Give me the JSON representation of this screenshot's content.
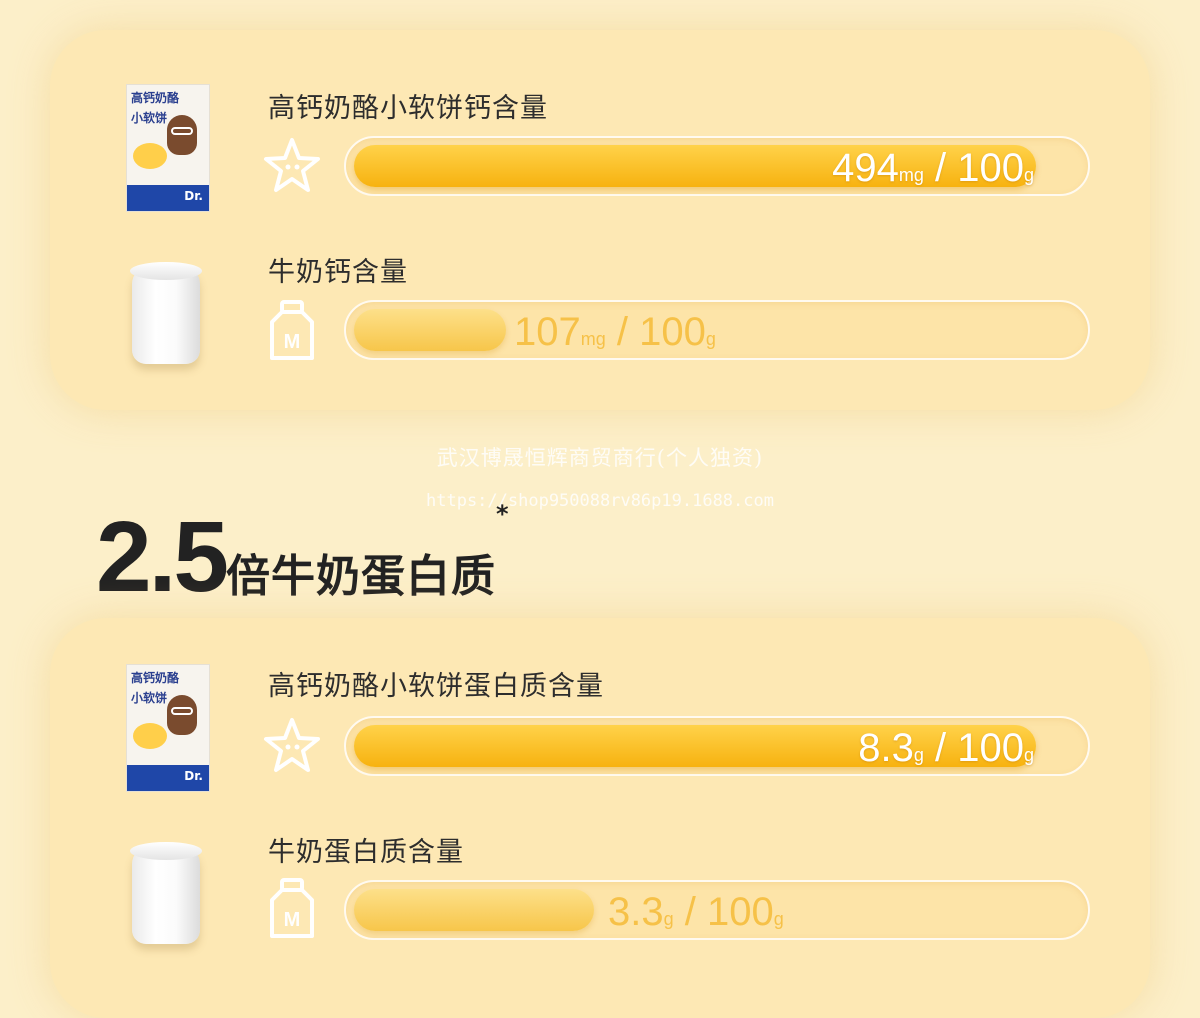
{
  "calcium": {
    "rows": [
      {
        "title": "高钙奶酪小软饼钙含量",
        "value": "494",
        "unit": "mg",
        "separator": "/",
        "base": "100",
        "base_unit": "g",
        "bar_fraction": 0.94,
        "icon": "star-icon"
      },
      {
        "title": "牛奶钙含量",
        "value": "107",
        "unit": "mg",
        "separator": "/",
        "base": "100",
        "base_unit": "g",
        "bar_fraction": 0.21,
        "icon": "milk-bottle-icon"
      }
    ]
  },
  "watermark": {
    "company": "武汉博晟恒辉商贸商行(个人独资)",
    "url": "https://shop950088rv86p19.1688.com"
  },
  "headline": {
    "multiplier": "2.5",
    "text": "倍牛奶蛋白质",
    "footnote_mark": "*"
  },
  "protein": {
    "rows": [
      {
        "title": "高钙奶酪小软饼蛋白质含量",
        "value": "8.3",
        "unit": "g",
        "separator": "/",
        "base": "100",
        "base_unit": "g",
        "bar_fraction": 0.94,
        "icon": "star-icon"
      },
      {
        "title": "牛奶蛋白质含量",
        "value": "3.3",
        "unit": "g",
        "separator": "/",
        "base": "100",
        "base_unit": "g",
        "bar_fraction": 0.33,
        "icon": "milk-bottle-icon"
      }
    ]
  },
  "product_pack": {
    "label_line1": "高钙奶酪",
    "label_line2": "小软饼"
  },
  "colors": {
    "background": "#fcefc9",
    "panel": "#fde8b4",
    "bar_strong": "#f7b20f",
    "bar_weak": "#f7c64a",
    "value_weak_text": "#f6c148"
  }
}
